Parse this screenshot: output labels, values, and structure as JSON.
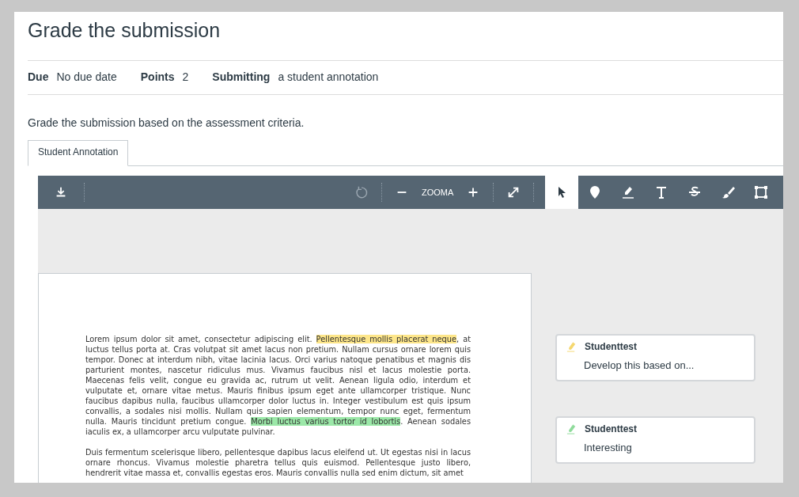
{
  "title": "Grade the submission",
  "details": [
    {
      "label": "Due",
      "value": "No due date"
    },
    {
      "label": "Points",
      "value": "2"
    },
    {
      "label": "Submitting",
      "value": "a student annotation"
    }
  ],
  "description": "Grade the submission based on the assessment criteria.",
  "tabs": [
    {
      "label": "Student Annotation",
      "selected": true
    }
  ],
  "toolbar": {
    "zoom_label": "ZOOMA",
    "tools": [
      {
        "kind": "pointer",
        "selected": true
      },
      {
        "kind": "point",
        "selected": false
      },
      {
        "kind": "highlight",
        "selected": false
      },
      {
        "kind": "text",
        "selected": false
      },
      {
        "kind": "strikeout",
        "selected": false
      },
      {
        "kind": "draw",
        "selected": false
      },
      {
        "kind": "area",
        "selected": false
      }
    ]
  },
  "document": {
    "paragraphs": [
      [
        {
          "text": "Lorem ipsum dolor sit amet, consectetur adipiscing elit. "
        },
        {
          "text": "Pellentesque mollis placerat neque",
          "color": "#fde68a"
        },
        {
          "text": ", at luctus tellus porta at. Cras volutpat sit amet lacus non pretium. Nullam cursus ornare lorem quis tempor. Donec at interdum nibh, vitae lacinia lacus. Orci varius natoque penatibus et magnis dis parturient montes, nascetur ridiculus mus. Vivamus faucibus nisl et lacus molestie porta. Maecenas felis velit, congue eu gravida ac, rutrum ut velit. Aenean ligula odio, interdum et vulputate et, ornare vitae metus. Mauris finibus ipsum eget ante ullamcorper tristique. Nunc faucibus dapibus nulla, faucibus ullamcorper dolor luctus in. Integer vestibulum est quis ipsum convallis, a sodales nisi mollis. Nullam quis sapien elementum, tempor nunc eget, fermentum nulla. Mauris tincidunt pretium congue. "
        },
        {
          "text": "Morbi luctus varius tortor id lobortis",
          "color": "#9be8a8"
        },
        {
          "text": ". Aenean sodales iaculis ex, a ullamcorper arcu vulputate pulvinar."
        }
      ],
      [
        {
          "text": "Duis fermentum scelerisque libero, pellentesque dapibus lacus eleifend ut. Ut egestas nisi in lacus ornare rhoncus. Vivamus molestie pharetra tellus quis euismod. Pellentesque justo libero, hendrerit vitae massa et, convallis egestas eros. Mauris convallis nulla sed enim dictum, sit amet"
        }
      ]
    ]
  },
  "comments": [
    {
      "author": "Studenttest",
      "text": "Develop this based on...",
      "color": "#f5d76e"
    },
    {
      "author": "Studenttest",
      "text": "Interesting",
      "color": "#8fdb9b"
    }
  ]
}
